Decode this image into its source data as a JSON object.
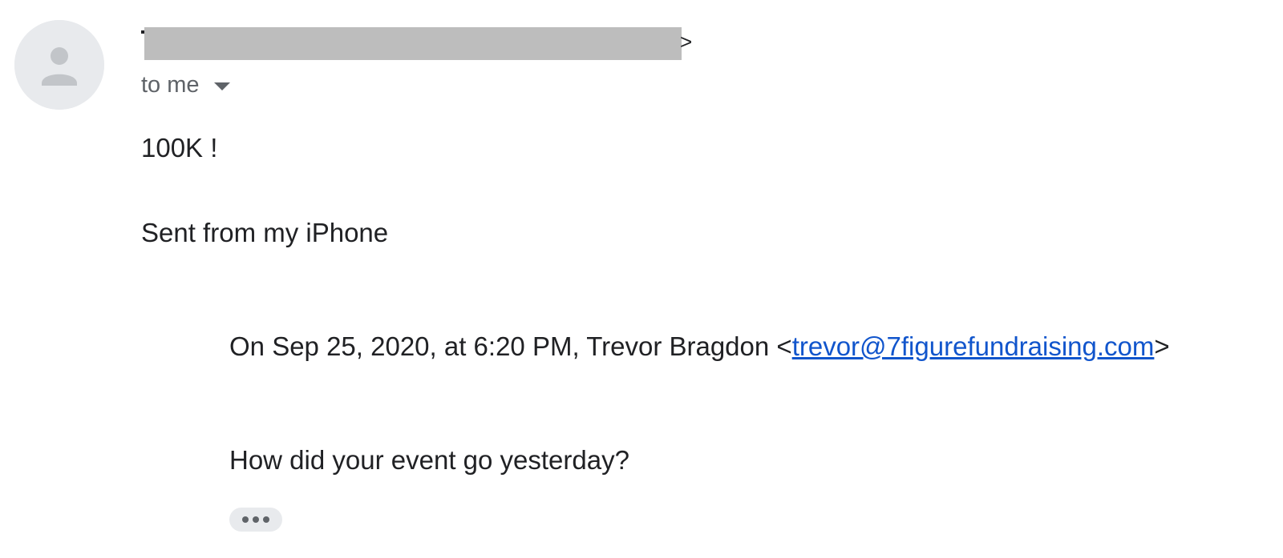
{
  "sender": {
    "trailing_char": ">"
  },
  "recipient": {
    "label": "to me"
  },
  "message": {
    "lines": [
      "100K !",
      "Sent from my iPhone"
    ]
  },
  "quoted": {
    "header_prefix": "On Sep 25, 2020, at 6:20 PM, Trevor Bragdon <",
    "email": "trevor@7figurefundraising.com",
    "header_suffix": ">",
    "body": "How did your event go yesterday?"
  },
  "icons": {
    "avatar": "person-icon",
    "recipient_toggle": "caret-down-icon",
    "show_trimmed": "more-horiz-icon"
  },
  "colors": {
    "link": "#1155cc",
    "secondary_text": "#5f6368",
    "redaction": "#bdbdbd"
  }
}
